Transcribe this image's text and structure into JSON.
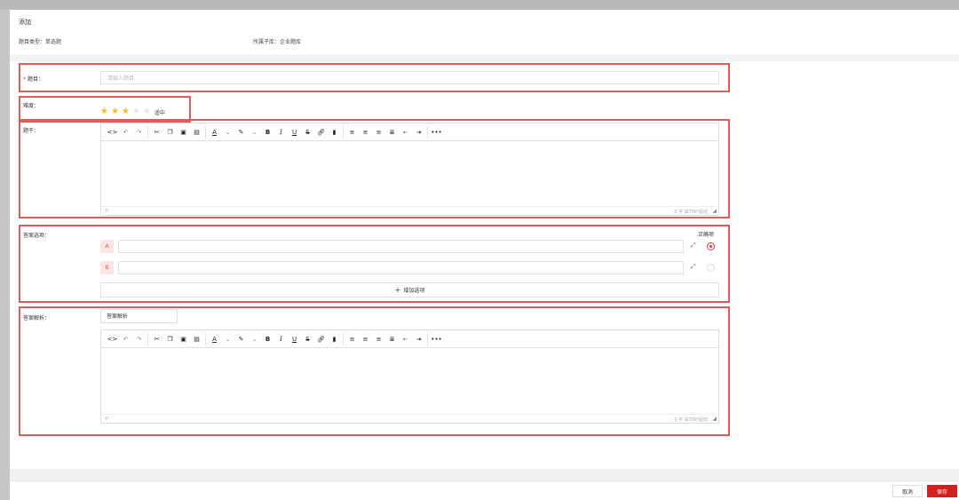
{
  "header": {
    "title": "添加",
    "question_type": "题目类型：单选题",
    "sub_bank": "所属子库：企业题库"
  },
  "form": {
    "subject_label": "题目：",
    "subject_placeholder": "请输入题目",
    "difficulty_label": "难度：",
    "difficulty_value": 3,
    "difficulty_max": 5,
    "difficulty_text": "适中",
    "stem_label": "题干：",
    "options_label": "答案选项：",
    "correct_header": "正确项",
    "options": [
      {
        "letter": "A",
        "value": "",
        "correct": true
      },
      {
        "letter": "B",
        "value": "",
        "correct": false
      }
    ],
    "add_option": "增加选项",
    "analysis_label": "答案解析：",
    "analysis_button": "答案解析"
  },
  "editor": {
    "status_p": "P",
    "status_count": "0 字 由TINY驱动",
    "toolbar": [
      "source-code-icon",
      "undo-icon",
      "redo-icon",
      "cut-icon",
      "copy-icon",
      "paste-icon",
      "paste-text-icon",
      "text-color-icon",
      "highlight-color-icon",
      "bold-icon",
      "italic-icon",
      "underline-icon",
      "strikethrough-icon",
      "link-icon",
      "anchor-icon",
      "align-left-icon",
      "align-center-icon",
      "align-right-icon",
      "align-justify-icon",
      "outdent-icon",
      "indent-icon",
      "more-icon"
    ]
  },
  "footer": {
    "cancel": "取消",
    "save": "保存"
  },
  "colors": {
    "accent": "#d21f1f",
    "highlight_border": "#e05a5a",
    "star": "#f7ba2a"
  }
}
